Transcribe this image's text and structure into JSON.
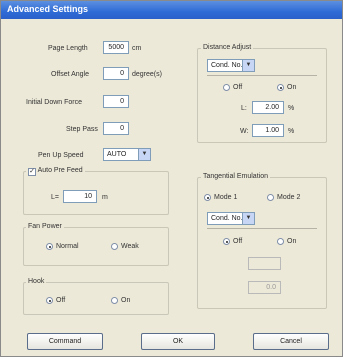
{
  "window": {
    "title": "Advanced Settings"
  },
  "left": {
    "page_length": {
      "label": "Page Length",
      "value": "5000",
      "unit": "cm"
    },
    "offset_angle": {
      "label": "Offset Angle",
      "value": "0",
      "unit": "degree(s)"
    },
    "initial_down_force": {
      "label": "Initial Down Force",
      "value": "0"
    },
    "step_pass": {
      "label": "Step Pass",
      "value": "0"
    },
    "pen_up_speed": {
      "label": "Pen Up Speed",
      "value": "AUTO"
    },
    "auto_pre_feed": {
      "label": "Auto Pre Feed",
      "checked": true,
      "prefix": "L=",
      "value": "10",
      "unit": "m"
    },
    "fan_power": {
      "title": "Fan Power",
      "options": [
        "Normal",
        "Weak"
      ],
      "selected": "Normal"
    },
    "hook": {
      "title": "Hook",
      "options": [
        "Off",
        "On"
      ],
      "selected": "Off"
    }
  },
  "distance_adjust": {
    "title": "Distance Adjust",
    "condition": "Cond. No. 1",
    "options": [
      "Off",
      "On"
    ],
    "selected": "On",
    "l_label": "L:",
    "l_value": "2.00",
    "w_label": "W:",
    "w_value": "1.00",
    "unit": "%"
  },
  "tangential_emulation": {
    "title": "Tangential Emulation",
    "modes": [
      "Mode 1",
      "Mode 2"
    ],
    "selected_mode": "Mode 1",
    "condition": "Cond. No. 1",
    "options": [
      "Off",
      "On"
    ],
    "selected": "Off",
    "field1_value": "",
    "field2_value": "0.0"
  },
  "buttons": {
    "command": "Command",
    "ok": "OK",
    "cancel": "Cancel"
  }
}
